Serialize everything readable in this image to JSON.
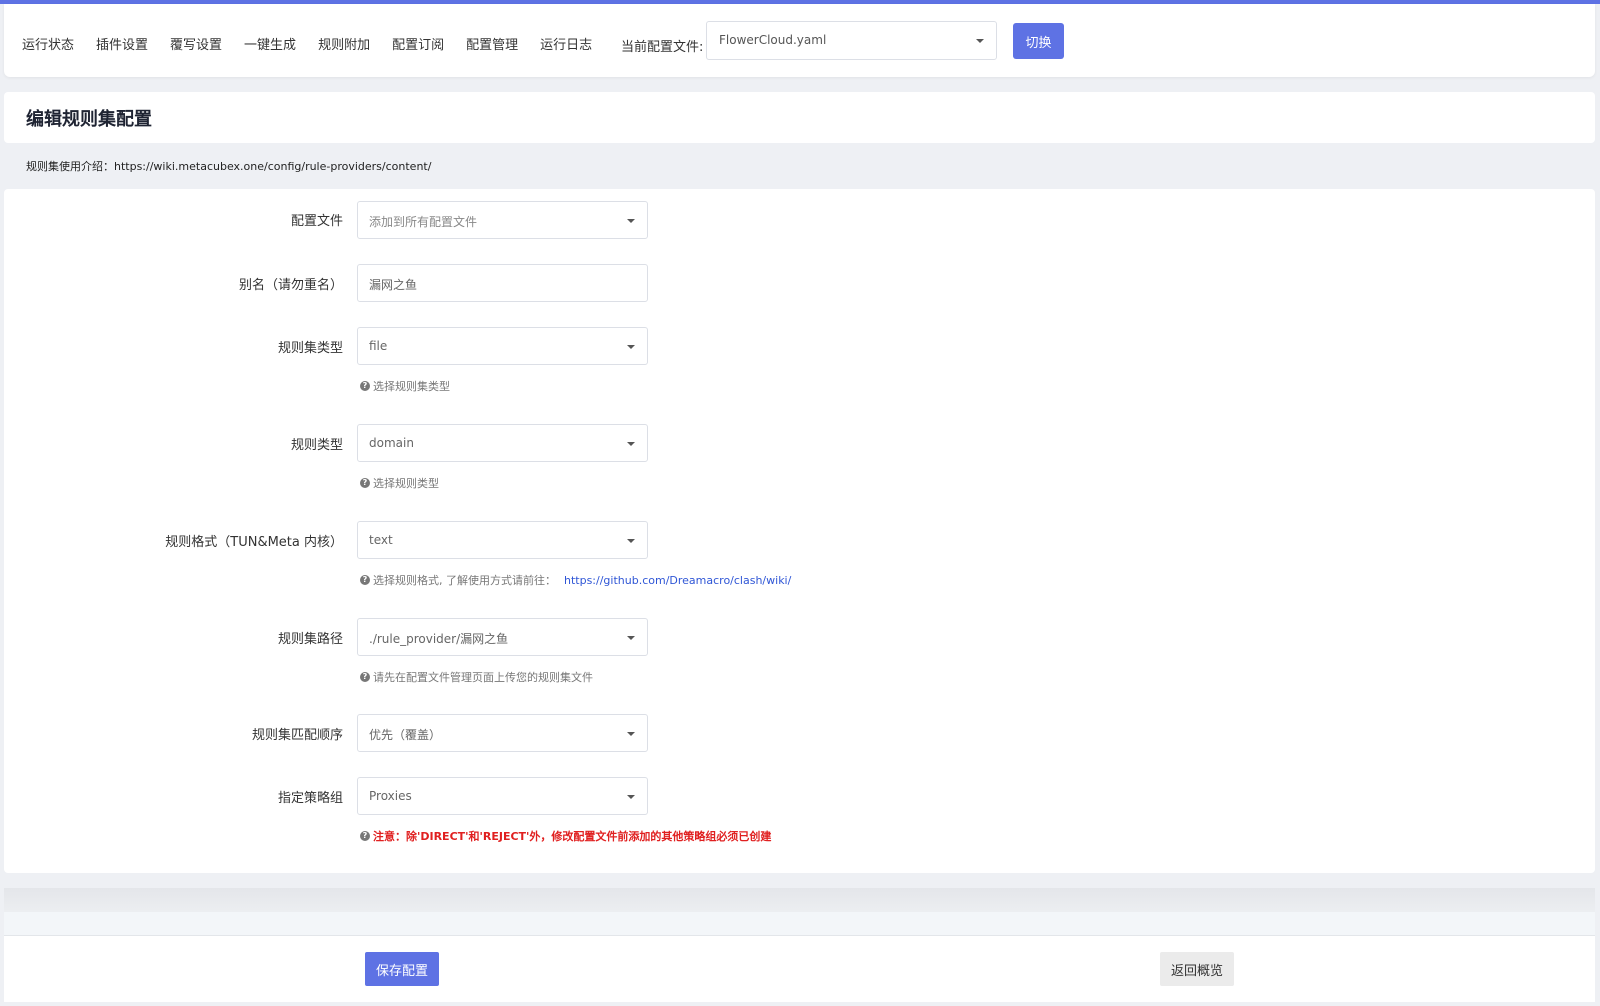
{
  "nav": {
    "tabs": [
      "运行状态",
      "插件设置",
      "覆写设置",
      "一键生成",
      "规则附加",
      "配置订阅",
      "配置管理",
      "运行日志"
    ],
    "current_label": "当前配置文件:",
    "current_file": "FlowerCloud.yaml",
    "switch_label": "切换"
  },
  "page_title": "编辑规则集配置",
  "intro": "规则集使用介绍：https://wiki.metacubex.one/config/rule-providers/content/",
  "form": {
    "config_file": {
      "label": "配置文件",
      "value": "添加到所有配置文件"
    },
    "alias": {
      "label": "别名（请勿重名）",
      "value": "漏网之鱼"
    },
    "ruleset_type": {
      "label": "规则集类型",
      "value": "file",
      "help": "选择规则集类型"
    },
    "rule_type": {
      "label": "规则类型",
      "value": "domain",
      "help": "选择规则类型"
    },
    "rule_format": {
      "label": "规则格式（TUN&Meta 内核）",
      "value": "text",
      "help": "选择规则格式, 了解使用方式请前往：",
      "help_link": "https://github.com/Dreamacro/clash/wiki/"
    },
    "ruleset_path": {
      "label": "规则集路径",
      "value": "./rule_provider/漏网之鱼",
      "help": "请先在配置文件管理页面上传您的规则集文件"
    },
    "match_order": {
      "label": "规则集匹配顺序",
      "value": "优先（覆盖）"
    },
    "policy_group": {
      "label": "指定策略组",
      "value": "Proxies",
      "warning": "注意：除'DIRECT'和'REJECT'外，修改配置文件前添加的其他策略组必须已创建"
    }
  },
  "footer": {
    "save_label": "保存配置",
    "back_label": "返回概览"
  },
  "colors": {
    "accent": "#5e72e4",
    "warning": "#e02020",
    "link": "#2f56d6"
  }
}
